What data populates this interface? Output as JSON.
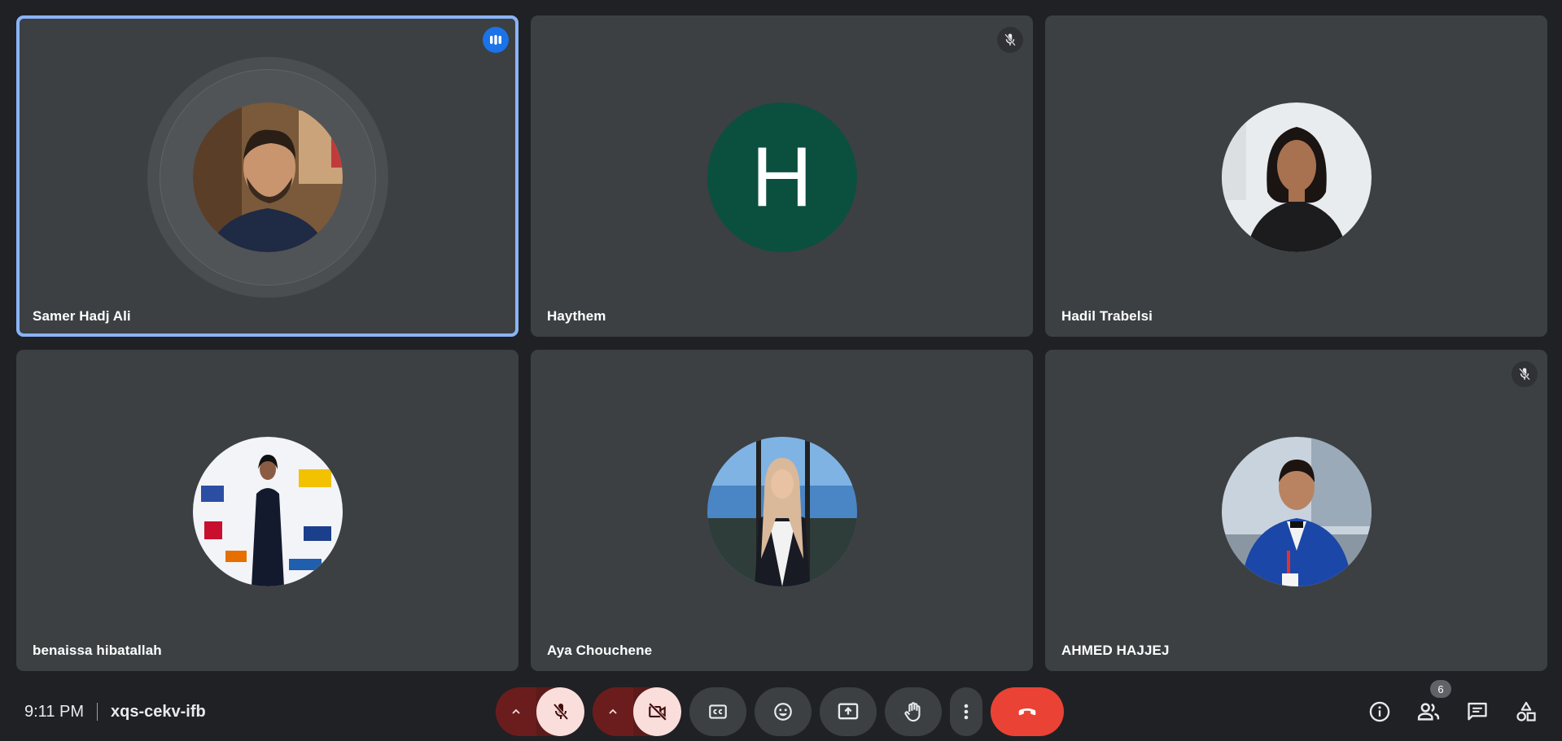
{
  "participants": [
    {
      "name": "Samer Hadj Ali",
      "speaking": true,
      "muted": false,
      "avatar": "photo"
    },
    {
      "name": "Haythem",
      "speaking": false,
      "muted": true,
      "avatar": "letter",
      "initial": "H",
      "avatar_color": "#0b4f3f"
    },
    {
      "name": "Hadil Trabelsi",
      "speaking": false,
      "muted": false,
      "avatar": "photo"
    },
    {
      "name": "benaissa hibatallah",
      "speaking": false,
      "muted": false,
      "avatar": "photo"
    },
    {
      "name": "Aya Chouchene",
      "speaking": false,
      "muted": false,
      "avatar": "photo"
    },
    {
      "name": "AHMED HAJJEJ",
      "speaking": false,
      "muted": true,
      "avatar": "photo"
    }
  ],
  "meeting": {
    "time": "9:11 PM",
    "code": "xqs-cekv-ifb"
  },
  "people_count": "6",
  "icons": {
    "mic": "mic-off-icon",
    "camera": "videocam-off-icon",
    "captions": "closed-captions-icon",
    "emoji": "emoji-icon",
    "present": "present-screen-icon",
    "raise_hand": "raise-hand-icon",
    "more": "more-vert-icon",
    "end_call": "end-call-icon",
    "info": "info-icon",
    "people": "people-icon",
    "chat": "chat-icon",
    "activities": "activities-icon"
  },
  "colors": {
    "background": "#202124",
    "tile": "#3c4043",
    "speaking_border": "#8ab4f8",
    "end_call": "#ea4335",
    "muted_button": "#f9dedc"
  }
}
